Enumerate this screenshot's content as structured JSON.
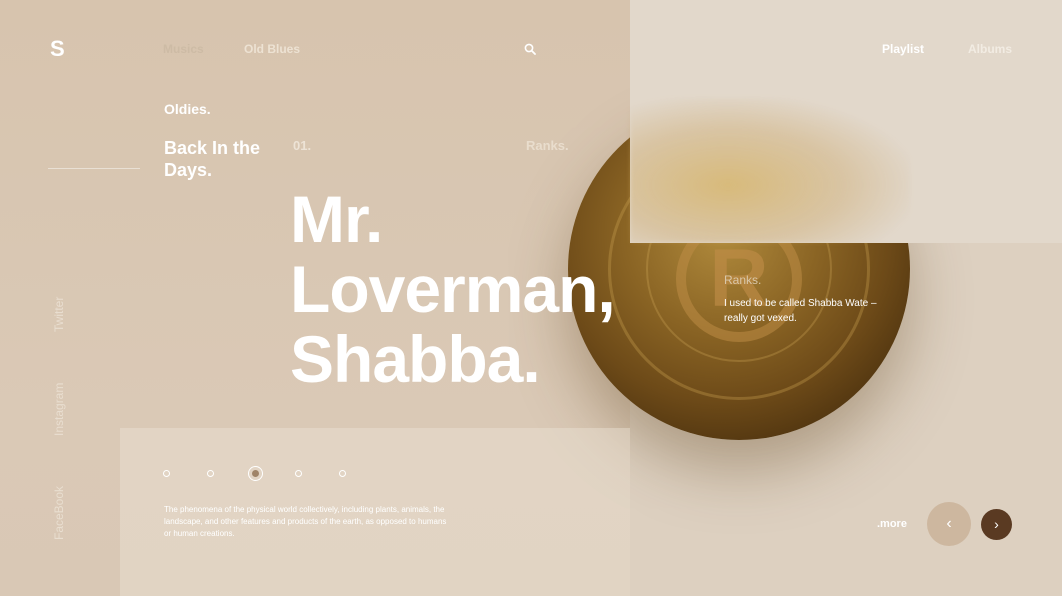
{
  "brand": {
    "logo_text": "S"
  },
  "nav": {
    "left_links": [
      {
        "label": "Musics"
      },
      {
        "label": "Old Blues"
      }
    ],
    "search_icon": "search-icon",
    "right_links": [
      {
        "label": "Playlist"
      },
      {
        "label": "Albums"
      }
    ]
  },
  "hero": {
    "subtitle": "Oldies.",
    "tagline": "Back In the Days.",
    "index": "01.",
    "ranks_faint": "Ranks.",
    "headline_lines": [
      "Mr.",
      "Loverman,",
      "Shabba."
    ]
  },
  "social": [
    {
      "label": "Twitter"
    },
    {
      "label": "Instagram"
    },
    {
      "label": "FaceBook"
    }
  ],
  "ranks_card": {
    "label": "Ranks.",
    "text": "I used to be called Shabba Wate – really got vexed."
  },
  "pager": {
    "count": 5,
    "active_index": 3
  },
  "description": "The phenomena of the physical world collectively, including plants, animals, the landscape, and other features and products of the earth, as opposed to humans or human creations.",
  "controls": {
    "more_label": ".more",
    "prev_icon": "chevron-left-icon",
    "next_icon": "chevron-right-icon",
    "prev_glyph": "‹",
    "next_glyph": "›"
  },
  "coin": {
    "mark": "R"
  },
  "colors": {
    "accent_dark": "#5a3a22",
    "accent_light": "#cdb79f",
    "background": "#d8c8b5"
  }
}
